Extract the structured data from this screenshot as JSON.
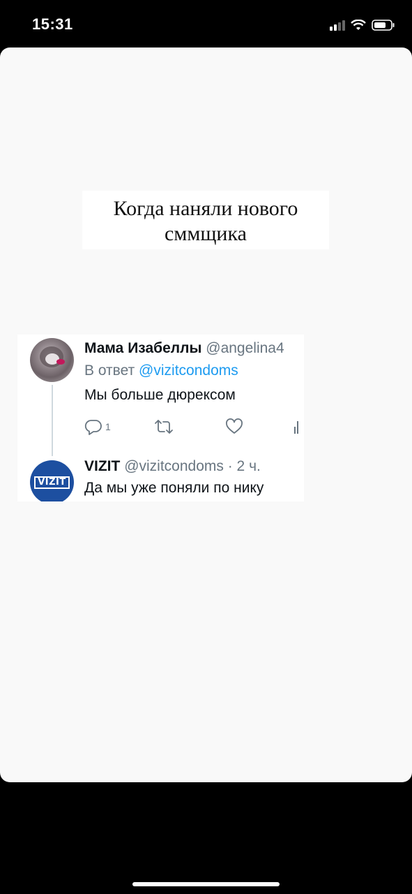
{
  "status_bar": {
    "time": "15:31",
    "icons": [
      "signal-icon",
      "wifi-icon",
      "battery-icon"
    ]
  },
  "caption": {
    "line1": "Когда наняли нового",
    "line2": "сммщика"
  },
  "tweet": {
    "author_name": "Мама Изабеллы",
    "author_handle": "@angelina4",
    "reply_prefix": "В ответ",
    "reply_to": "@vizitcondoms",
    "text": "Мы больше дюрексом",
    "reply_count": "1",
    "icons": [
      "reply-icon",
      "retweet-icon",
      "like-icon",
      "views-icon"
    ]
  },
  "reply": {
    "author_name": "VIZIT",
    "author_handle": "@vizitcondoms",
    "time": "· 2 ч.",
    "text": "Да мы уже поняли по нику",
    "logo_text": "VIZIT"
  },
  "colors": {
    "link": "#1d9bf0",
    "handle": "#687580",
    "vizit_blue": "#1d4fa0"
  }
}
